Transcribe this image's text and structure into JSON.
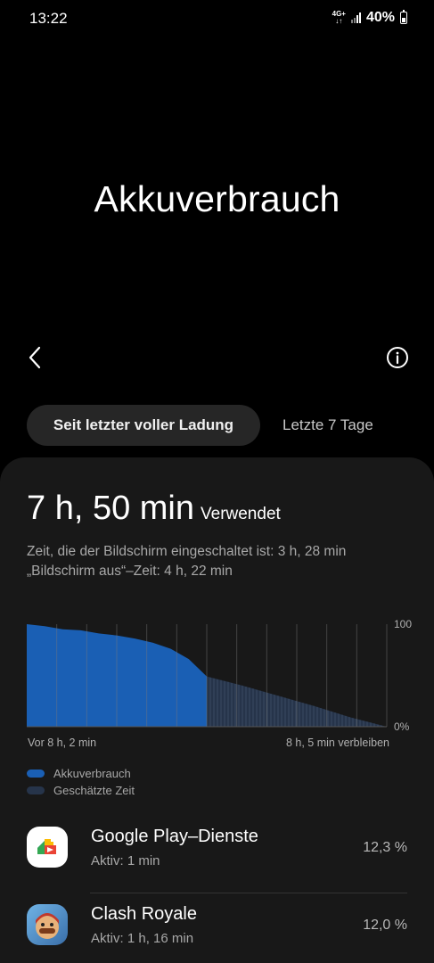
{
  "status": {
    "time": "13:22",
    "network_top": "4G+",
    "network_bottom": "↓↑",
    "battery": "40%"
  },
  "page": {
    "title": "Akkuverbrauch"
  },
  "tabs": [
    {
      "label": "Seit letzter voller Ladung",
      "active": true
    },
    {
      "label": "Letzte 7 Tage",
      "active": false
    }
  ],
  "usage": {
    "value": "7 h, 50 min",
    "label": "Verwendet",
    "screen_on": "Zeit, die der Bildschirm eingeschaltet ist: 3 h, 28 min",
    "screen_off": "„Bildschirm aus“–Zeit: 4 h, 22 min"
  },
  "chart_data": {
    "type": "area",
    "ylim": [
      0,
      100
    ],
    "y_tick_labels": [
      "100",
      "0%"
    ],
    "x_start_label": "Vor 8 h, 2 min",
    "x_end_label": "8 h, 5 min verbleiben",
    "series": [
      {
        "name": "Akkuverbrauch",
        "color": "#1a5fb4",
        "x": [
          0,
          5,
          10,
          15,
          20,
          25,
          30,
          35,
          40,
          45,
          50
        ],
        "y": [
          100,
          98,
          95,
          94,
          91,
          89,
          86,
          82,
          76,
          66,
          49
        ]
      },
      {
        "name": "Geschätzte Zeit",
        "color": "#26344a",
        "x": [
          50,
          60,
          70,
          80,
          90,
          100
        ],
        "y": [
          49,
          40,
          30,
          20,
          9,
          0
        ]
      }
    ]
  },
  "legend": [
    {
      "label": "Akkuverbrauch",
      "color": "#1a5fb4"
    },
    {
      "label": "Geschätzte Zeit",
      "color": "#26344a"
    }
  ],
  "apps": [
    {
      "name": "Google Play–Dienste",
      "active": "Aktiv: 1 min",
      "percent": "12,3 %",
      "icon": "google-play-services-icon"
    },
    {
      "name": "Clash Royale",
      "active": "Aktiv: 1 h, 16 min",
      "percent": "12,0 %",
      "icon": "clash-royale-icon"
    }
  ]
}
